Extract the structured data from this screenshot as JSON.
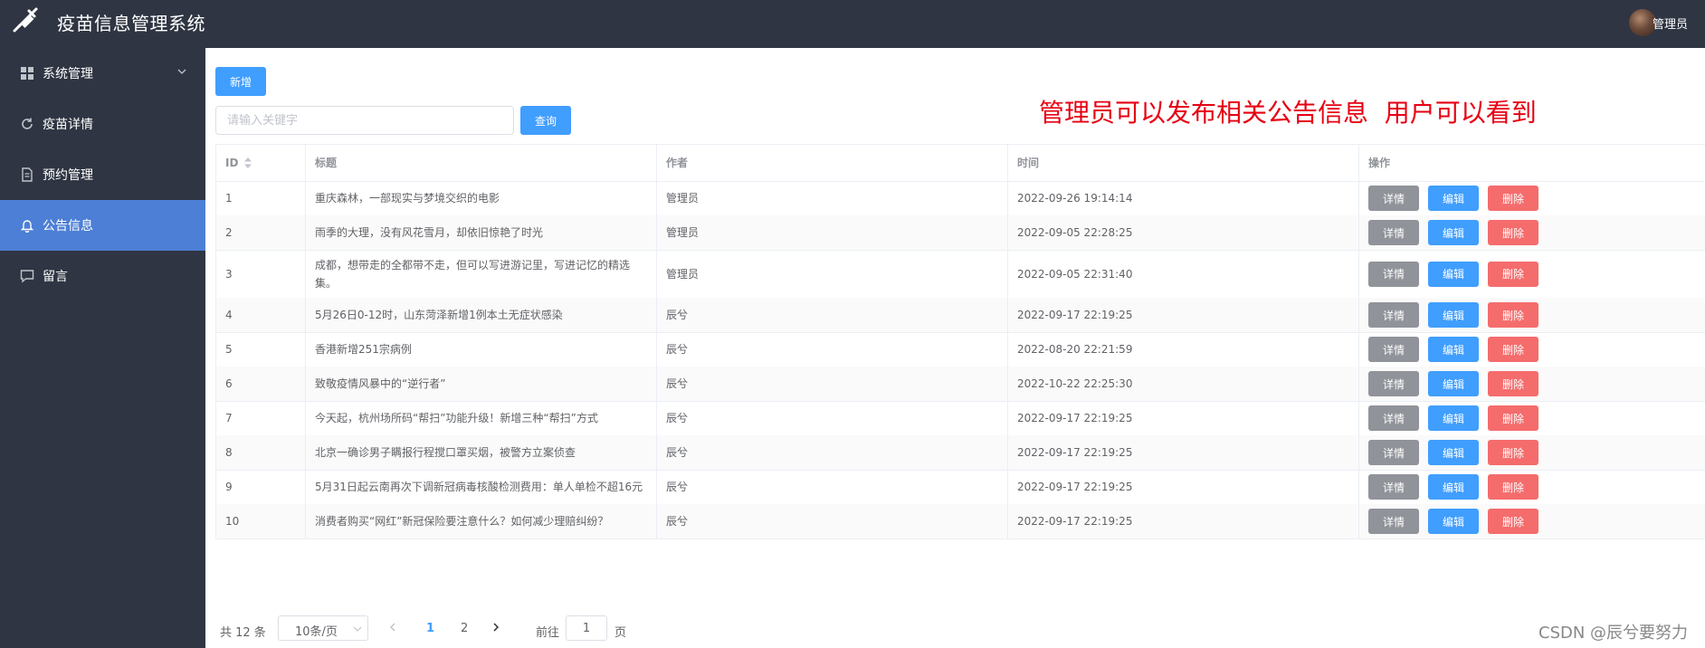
{
  "app": {
    "title": "疫苗信息管理系统",
    "user_name": "管理员"
  },
  "sidebar": {
    "items": [
      {
        "label": "系统管理",
        "icon": "grid-icon",
        "has_arrow": true,
        "active": false
      },
      {
        "label": "疫苗详情",
        "icon": "refresh-icon",
        "active": false
      },
      {
        "label": "预约管理",
        "icon": "document-icon",
        "active": false
      },
      {
        "label": "公告信息",
        "icon": "bell-icon",
        "active": true
      },
      {
        "label": "留言",
        "icon": "chat-icon",
        "active": false
      }
    ]
  },
  "toolbar": {
    "add_label": "新增",
    "search_placeholder": "请输入关键字",
    "search_value": "",
    "query_label": "查询"
  },
  "annotation": "管理员可以发布相关公告信息  用户可以看到",
  "table": {
    "headers": [
      "ID",
      "标题",
      "作者",
      "时间",
      "操作"
    ],
    "actions": [
      "详情",
      "编辑",
      "删除"
    ],
    "rows": [
      {
        "id": "1",
        "title": "重庆森林，一部现实与梦境交织的电影",
        "author": "管理员",
        "time": "2022-09-26 19:14:14"
      },
      {
        "id": "2",
        "title": "雨季的大理，没有风花雪月，却依旧惊艳了时光",
        "author": "管理员",
        "time": "2022-09-05 22:28:25"
      },
      {
        "id": "3",
        "title": "成都，想带走的全都带不走，但可以写进游记里，写进记忆的精选集。",
        "author": "管理员",
        "time": "2022-09-05 22:31:40"
      },
      {
        "id": "4",
        "title": "5月26日0-12时，山东菏泽新增1例本土无症状感染",
        "author": "辰兮",
        "time": "2022-09-17 22:19:25"
      },
      {
        "id": "5",
        "title": "香港新增251宗病例",
        "author": "辰兮",
        "time": "2022-08-20 22:21:59"
      },
      {
        "id": "6",
        "title": "致敬疫情风暴中的“逆行者”",
        "author": "辰兮",
        "time": "2022-10-22 22:25:30"
      },
      {
        "id": "7",
        "title": "今天起，杭州场所码“帮扫”功能升级！新增三种“帮扫”方式",
        "author": "辰兮",
        "time": "2022-09-17 22:19:25"
      },
      {
        "id": "8",
        "title": "北京一确诊男子瞒报行程搅口罩买烟，被警方立案侦查",
        "author": "辰兮",
        "time": "2022-09-17 22:19:25"
      },
      {
        "id": "9",
        "title": "5月31日起云南再次下调新冠病毒核酸检测费用：单人单检不超16元",
        "author": "辰兮",
        "time": "2022-09-17 22:19:25"
      },
      {
        "id": "10",
        "title": "消费者购买“网红”新冠保险要注意什么？如何减少理赔纠纷？",
        "author": "辰兮",
        "time": "2022-09-17 22:19:25"
      }
    ]
  },
  "pagination": {
    "total_label": "共 12 条",
    "page_size": "10条/页",
    "pages": [
      "1",
      "2"
    ],
    "current_page": "1",
    "goto_label": "前往",
    "goto_value": "1",
    "page_suffix": "页"
  },
  "watermark": "CSDN @辰兮要努力",
  "colors": {
    "sidebar_bg": "#2f3542",
    "active_bg": "#4d7fd6",
    "primary": "#409eff",
    "info": "#909399",
    "danger": "#f56c6c",
    "annotation": "#e60012"
  }
}
